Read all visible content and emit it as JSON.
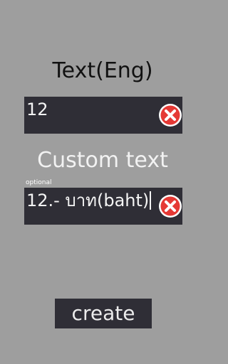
{
  "text_eng": {
    "heading": "Text(Eng)",
    "value": "12",
    "clear_icon": "clear-x-icon"
  },
  "custom_text": {
    "heading": "Custom text",
    "optional_label": "optional",
    "value": "12.- บาท(baht)",
    "clear_icon": "clear-x-icon"
  },
  "actions": {
    "create_label": "create"
  },
  "colors": {
    "background": "#9e9e9e",
    "field_background": "#2f2e36",
    "clear_icon_red": "#e53935"
  }
}
